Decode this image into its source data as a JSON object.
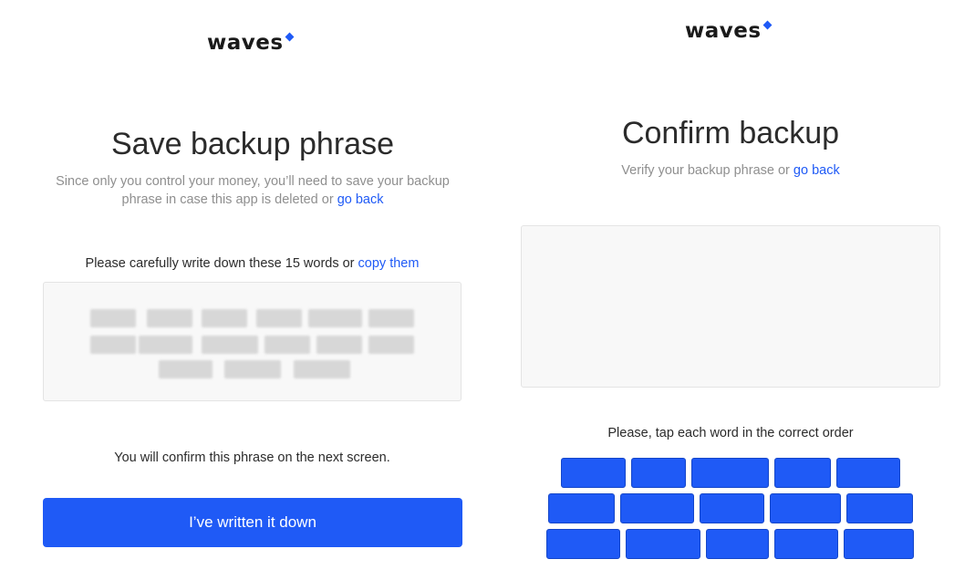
{
  "colors": {
    "accent": "#1f5af6",
    "muted_text": "#8f8f8f",
    "box_background": "#f8f8f8"
  },
  "save_screen": {
    "logo": "waves",
    "title": "Save backup phrase",
    "subtitle_line1": "Since only you control your money, you’ll need to save your backup",
    "subtitle_line2_prefix": "phrase in case this app is deleted or ",
    "subtitle_link": "go back",
    "instruction_prefix": "Please carefully write down these 15 words or ",
    "instruction_link": "copy them",
    "hidden_word_count": 15,
    "note": "You will confirm this phrase on the next screen.",
    "button_label": "I’ve written it down"
  },
  "confirm_screen": {
    "logo": "waves",
    "title": "Confirm backup",
    "subtitle_prefix": "Verify your backup phrase or ",
    "subtitle_link": "go back",
    "instruction": "Please, tap each word in the correct order",
    "word_button_count": 15
  }
}
